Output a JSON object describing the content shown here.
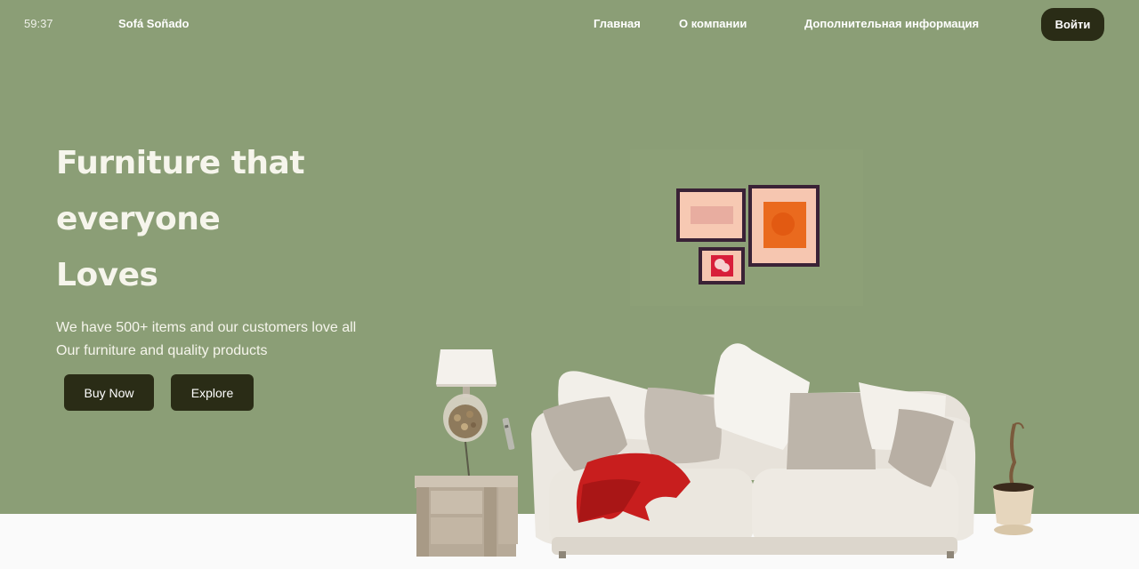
{
  "header": {
    "timer": "59:37",
    "brand": "Sofá Soñado",
    "nav": [
      "Главная",
      "О компании",
      "Дополнительная информация"
    ],
    "login_label": "Войти"
  },
  "hero": {
    "headline": [
      "Furniture that",
      "everyone",
      "Loves"
    ],
    "subtext": [
      "We have 500+ items and our customers love all",
      "Our furniture and quality products"
    ],
    "buttons": {
      "buy_now": "Buy Now",
      "explore": "Explore"
    }
  },
  "illustration": {
    "items": [
      "wall-art-frames",
      "table-lamp",
      "nightstand",
      "sofa",
      "red-throw-blanket",
      "potted-plant",
      "remote-control"
    ]
  },
  "colors": {
    "hero_bg": "#8b9e76",
    "floor_bg": "#fafafa",
    "button_bg": "#2a2c16",
    "text_light": "#f6f5ec"
  }
}
